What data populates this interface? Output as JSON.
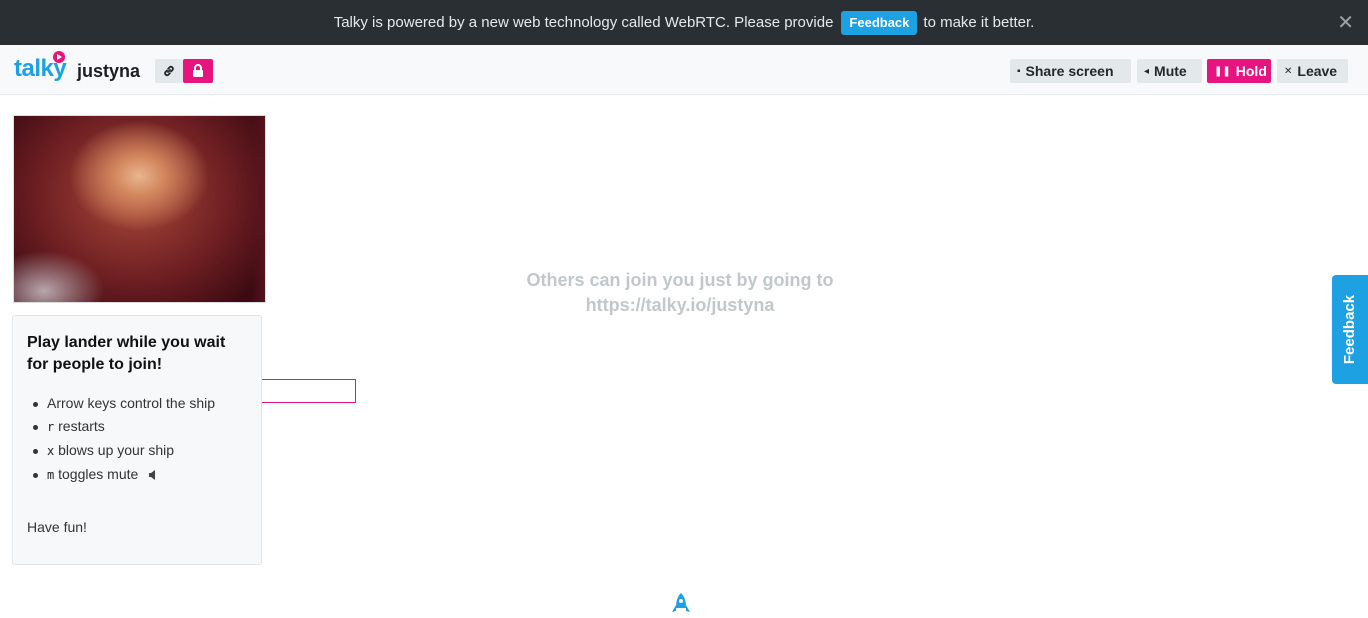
{
  "banner": {
    "message": "Talky is powered by a new web technology called WebRTC. Please provide",
    "feedback_label": "Feedback",
    "suffix": "to make it better.",
    "close_glyph": "✕"
  },
  "header": {
    "logo_text": "talky",
    "room_name": "justyna",
    "link_icon": "link-icon",
    "lock_icon": "lock-icon",
    "buttons": {
      "share": "Share screen",
      "mute": "Mute",
      "hold": "Hold",
      "leave": "Leave"
    }
  },
  "colors": {
    "brand_blue": "#1da1e2",
    "brand_pink": "#e5147f",
    "banner_bg": "#2a2f33"
  },
  "game": {
    "title": "Play lander while you wait for people to join!",
    "items": [
      {
        "code": "",
        "text": "Arrow keys control the ship"
      },
      {
        "code": "r",
        "text": "restarts"
      },
      {
        "code": "x",
        "text": "blows up your ship"
      },
      {
        "code": "m",
        "text": "toggles mute"
      }
    ],
    "outro": "Have fun!"
  },
  "main": {
    "hint_line1": "Others can join you just by going to",
    "hint_line2": "https://talky.io/justyna"
  },
  "side_feedback": {
    "label": "Feedback"
  }
}
